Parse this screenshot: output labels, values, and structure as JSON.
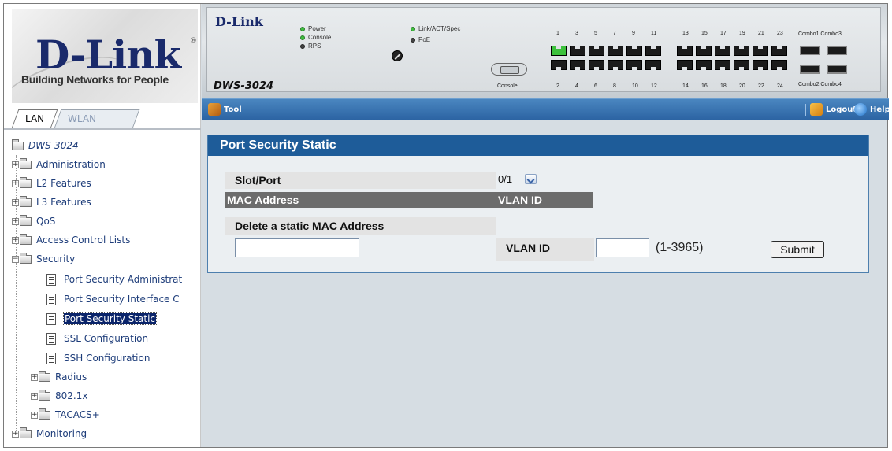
{
  "brand": {
    "logo_text": "D-Link",
    "registered_mark": "®",
    "tagline": "Building Networks for People"
  },
  "side_tabs": [
    {
      "label": "LAN",
      "active": true
    },
    {
      "label": "WLAN",
      "active": false
    }
  ],
  "tree": {
    "root": "DWS-3024",
    "items": [
      {
        "label": "Administration",
        "type": "folder",
        "expanded": false
      },
      {
        "label": "L2 Features",
        "type": "folder",
        "expanded": false
      },
      {
        "label": "L3 Features",
        "type": "folder",
        "expanded": false
      },
      {
        "label": "QoS",
        "type": "folder",
        "expanded": false
      },
      {
        "label": "Access Control Lists",
        "type": "folder",
        "expanded": false
      },
      {
        "label": "Security",
        "type": "folder",
        "expanded": true
      },
      {
        "label": "Port Security Administrat",
        "type": "page"
      },
      {
        "label": "Port Security Interface C",
        "type": "page"
      },
      {
        "label": "Port Security Static",
        "type": "page",
        "selected": true
      },
      {
        "label": "SSL Configuration",
        "type": "page"
      },
      {
        "label": "SSH Configuration",
        "type": "page"
      },
      {
        "label": "Radius",
        "type": "folder",
        "expanded": false
      },
      {
        "label": "802.1x",
        "type": "folder",
        "expanded": false
      },
      {
        "label": "TACACS+",
        "type": "folder",
        "expanded": false
      },
      {
        "label": "Monitoring",
        "type": "folder",
        "expanded": false
      }
    ]
  },
  "device": {
    "brand": "D-Link",
    "model": "DWS-3024",
    "leds": [
      {
        "label": "Power",
        "color": "green"
      },
      {
        "label": "Console",
        "color": "green"
      },
      {
        "label": "RPS",
        "color": "dark"
      },
      {
        "label": "Link/ACT/Spec",
        "color": "green"
      },
      {
        "label": "PoE",
        "color": "dark"
      }
    ],
    "console_label": "Console",
    "top_ports": [
      "1",
      "3",
      "5",
      "7",
      "9",
      "11",
      "13",
      "15",
      "17",
      "19",
      "21",
      "23"
    ],
    "bottom_ports": [
      "2",
      "4",
      "6",
      "8",
      "10",
      "12",
      "14",
      "16",
      "18",
      "20",
      "22",
      "24"
    ],
    "active_port": "1",
    "combo_top": "Combo1 Combo3",
    "combo_bottom": "Combo2 Combo4"
  },
  "toolbar": {
    "tool": "Tool",
    "logout": "Logout",
    "help": "Help",
    "colors": {
      "bar": "#2c64a3",
      "title": "#1e5c99"
    }
  },
  "form": {
    "title": "Port Security Static",
    "slot_port_label": "Slot/Port",
    "slot_port_value": "0/1",
    "mac_address_header": "MAC Address",
    "vlan_id_header": "VLAN ID",
    "delete_label": "Delete a static MAC Address",
    "mac_input_value": "",
    "vlan_label": "VLAN ID",
    "vlan_input_value": "",
    "vlan_range": "(1-3965)",
    "submit": "Submit"
  }
}
